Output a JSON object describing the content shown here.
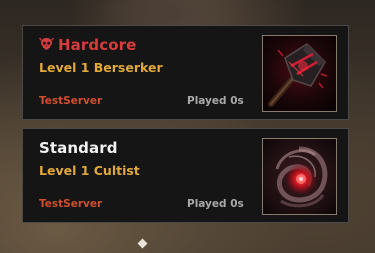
{
  "characters": [
    {
      "mode": "Hardcore",
      "mode_icon": "skull-icon",
      "description": "Level 1 Berserker",
      "server": "TestServer",
      "played": "Played 0s",
      "portrait": "berserker-axe-portrait"
    },
    {
      "mode": "Standard",
      "description": "Level 1 Cultist",
      "server": "TestServer",
      "played": "Played 0s",
      "portrait": "cultist-vortex-portrait"
    }
  ],
  "colors": {
    "hardcore_title": "#d63c3c",
    "standard_title": "#f2f2f2",
    "level_text": "#e0a93c",
    "server_text": "#cf4f2e",
    "played_text": "#a9a9a9",
    "card_bg": "#151515"
  }
}
